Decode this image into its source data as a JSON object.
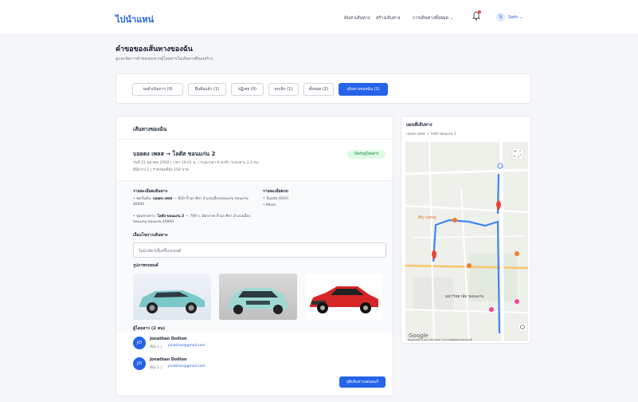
{
  "header": {
    "logo": "ไปนำแหน่",
    "nav": [
      "ค้นหาเส้นทาง",
      "สร้างเส้นทาง",
      "การเดินทางทั้งหมด ⌄"
    ],
    "user": "Seth ⌄",
    "user_initial": "S"
  },
  "page": {
    "title": "คำขอของเส้นทางของฉัน",
    "subtitle": "ดูและจัดการคำขอของจากผู้โดยสารในเส้นทางที่คุณสร้าง"
  },
  "tabs": [
    {
      "label": "รอดำเนินการ (0)",
      "active": false
    },
    {
      "label": "ยืนยันแล้ว (1)",
      "active": false
    },
    {
      "label": "ปฏิเสธ (0)",
      "active": false
    },
    {
      "label": "ยกเลิก (1)",
      "active": false
    },
    {
      "label": "ทั้งหมด (2)",
      "active": false
    },
    {
      "label": "เส้นทางของฉัน (1)",
      "active": true
    }
  ],
  "route_card": {
    "section_title": "เส้นทางของฉัน",
    "route_title": "บอยตง เพลส → โลตัส ขอนแก่น 2",
    "meta_line1": "วันที่ 21 ตุลาคม 2568  |  เวลา 19:01 น.  |  ระยะเวลา 9 นาที  |  ระยะทาง 3.3 กม.",
    "meta_line2": "ที่นั่งว่าง 2  |  ราคาต่อที่นั่ง 250 บาท",
    "status": "เปิดรับผู้โดยสาร",
    "details_heading": "รายละเอียดเส้นทาง",
    "start_prefix": "• จุดเริ่มต้น:",
    "start_name": "บอยตง เพลส",
    "start_addr": "— 820 ถ้ำนก ศิลา อำเภอเมืองขอนแก่น ขอนแก่น 40000",
    "end_prefix": "• จุดปลายทาง:",
    "end_name": "โลตัส ขอนแก่น 2",
    "end_addr": "— 709 ถ. มิตรภาพ ถ้ำนก ศิลา อำเภอเมืองขอนแก่น ขอนแก่น 40000",
    "car_heading": "รายละเอียดรถ",
    "car_items": [
      "• Toyota (SUV)",
      "• Music"
    ],
    "conditions_heading": "เงื่อนไขการเดินทาง",
    "conditions_value": "ไม่นำสัตว์เลี้ยงขึ้นรถยนต์",
    "photos_heading": "รูปภาพรถยนต์",
    "passengers_heading": "ผู้โดยสาร (2 คน)",
    "passengers": [
      {
        "initials": "JO",
        "name": "Jonathan Dollion",
        "seat": "ที่นั่ง 1  |",
        "email": "jonathan@gmail.com"
      },
      {
        "initials": "JO",
        "name": "Jonathan Dollion",
        "seat": "ที่นั่ง 1  |",
        "email": "jonathan@gmail.com"
      }
    ],
    "cancel_button": "ยุติเส้นทางเสนอแก้"
  },
  "map_card": {
    "title": "แผนที่เส้นทาง",
    "subtitle": "บอยตง เพลส → โลตัส ขอนแก่น 2",
    "labels": [
      "My camp",
      "มหาวิทยาลัย ขอนแก่น",
      "Google"
    ],
    "attribution": "ข้อมูลแผนที่ ©2025  ข้อกำหนด  รายงานข้อผิดพลาดของแผนที่"
  },
  "colors": {
    "primary": "#2563eb",
    "success_bg": "#dcfce7",
    "success_text": "#15803d",
    "route": "#4285f4",
    "pin": "#ea4335"
  }
}
